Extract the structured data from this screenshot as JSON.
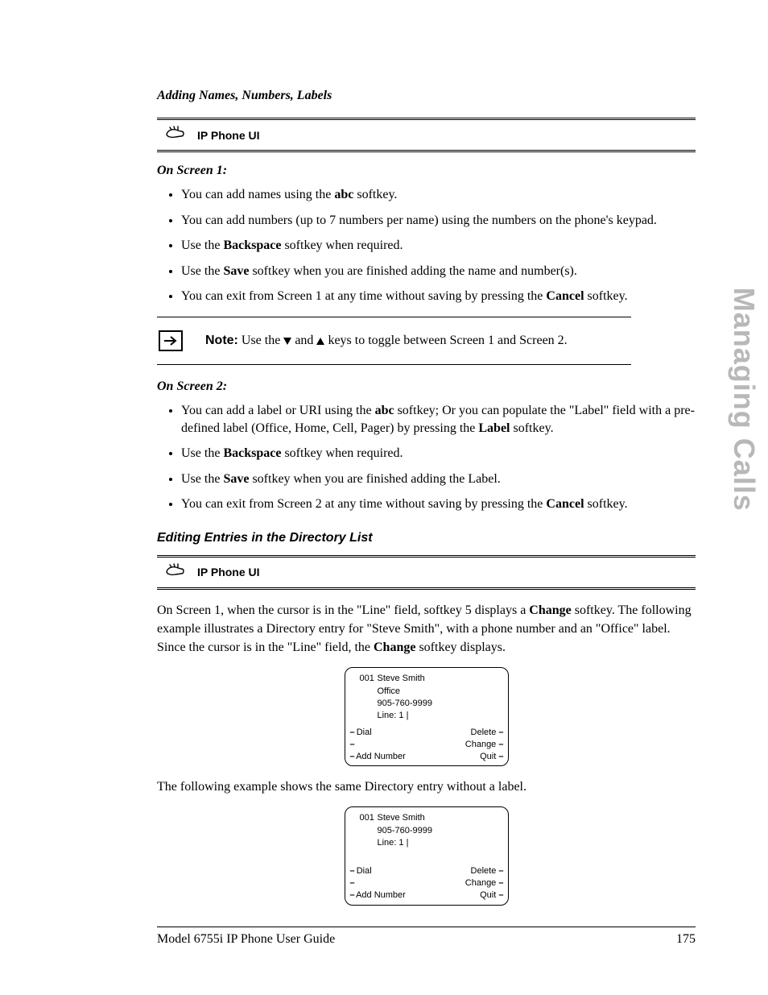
{
  "section_title": "Adding Names, Numbers, Labels",
  "banner1_label": "IP Phone UI",
  "screen1_head": "On Screen 1:",
  "screen1_items": {
    "i0": {
      "pre": "You can add names using the ",
      "bold": "abc",
      "post": " softkey."
    },
    "i1": {
      "text": "You can add numbers (up to 7 numbers per name) using the numbers on the phone's keypad."
    },
    "i2": {
      "pre": "Use the ",
      "bold": "Backspace",
      "post": " softkey when required."
    },
    "i3": {
      "pre": "Use the ",
      "bold": "Save",
      "post": " softkey when you are finished adding the name and number(s)."
    },
    "i4": {
      "pre": "You can exit from Screen 1 at any time without saving by pressing the ",
      "bold": "Cancel",
      "post": " softkey."
    }
  },
  "note": {
    "label": "Note:",
    "pre": " Use the ",
    "mid": " and ",
    "post": " keys to toggle between Screen 1 and Screen 2."
  },
  "screen2_head": "On Screen 2:",
  "screen2_items": {
    "i0": {
      "pre": "You can add a label or URI using the ",
      "bold1": "abc",
      "mid": " softkey; Or you can populate the \"Label\" field with a pre-defined label (Office, Home, Cell, Pager) by pressing the ",
      "bold2": "Label",
      "post": " softkey."
    },
    "i1": {
      "pre": "Use the ",
      "bold": "Backspace",
      "post": " softkey when required."
    },
    "i2": {
      "pre": "Use the ",
      "bold": "Save",
      "post": " softkey when you are finished adding the Label."
    },
    "i3": {
      "pre": "You can exit from Screen 2 at any time without saving by pressing the ",
      "bold": "Cancel",
      "post": " softkey."
    }
  },
  "edit_heading": "Editing Entries in the Directory List",
  "banner2_label": "IP Phone UI",
  "para1": {
    "pre": "On Screen 1, when the cursor is in the \"Line\" field, softkey 5 displays a ",
    "bold1": "Change",
    "mid": " softkey. The following example illustrates a Directory entry for \"Steve Smith\", with a phone number and an \"Office\" label. Since the cursor is in the \"Line\" field, the ",
    "bold2": "Change",
    "post": " softkey displays."
  },
  "phone1": {
    "idx": "001",
    "name": "Steve Smith",
    "label": "Office",
    "number": "905-760-9999",
    "line": "Line: 1 |",
    "sk": {
      "dial": "Dial",
      "addnum": "Add Number",
      "delete": "Delete",
      "change": "Change",
      "quit": "Quit"
    }
  },
  "para2": "The following example shows the same Directory entry without a label.",
  "phone2": {
    "idx": "001",
    "name": "Steve Smith",
    "number": "905-760-9999",
    "line": "Line: 1 |",
    "sk": {
      "dial": "Dial",
      "addnum": "Add Number",
      "delete": "Delete",
      "change": "Change",
      "quit": "Quit"
    }
  },
  "footer": {
    "left": "Model 6755i IP Phone User Guide",
    "right": "175"
  },
  "side_tab": "Managing Calls"
}
